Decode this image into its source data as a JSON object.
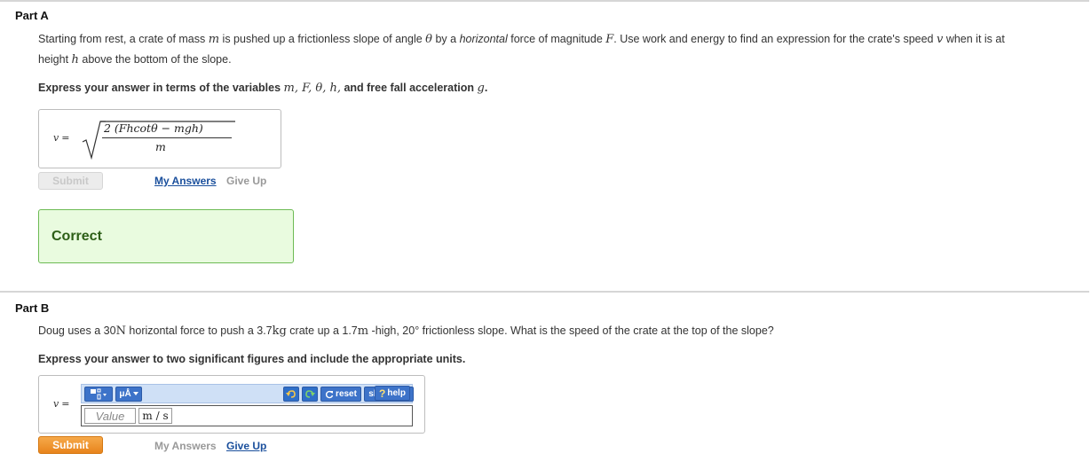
{
  "partA": {
    "title": "Part A",
    "q_p1": "Starting from rest, a crate of mass ",
    "q_m": "m",
    "q_p2": " is pushed up a frictionless slope of angle ",
    "q_theta": "θ",
    "q_p3": " by a ",
    "q_horizontal": "horizontal",
    "q_p4": " force of magnitude ",
    "q_F": "F",
    "q_p5": ". Use work and energy to find an expression for the crate's speed ",
    "q_v": "v",
    "q_p6": " when it is at",
    "q_p7": "height ",
    "q_h": "h",
    "q_p8": " above the bottom of the slope.",
    "instr_p1": "Express your answer in terms of the variables ",
    "instr_vars": "m, F, θ, h,",
    "instr_p2": " and free fall acceleration ",
    "instr_g": "g",
    "instr_p3": ".",
    "answer_var": "v",
    "answer_eq": "=",
    "answer_numerator": "2 (Fhcotθ − mgh)",
    "answer_denominator": "m",
    "submit_label": "Submit",
    "my_answers_label": "My Answers",
    "give_up_label": "Give Up",
    "correct_label": "Correct"
  },
  "partB": {
    "title": "Part B",
    "q_p1": "Doug uses a 30",
    "q_N": "N",
    "q_p2": " horizontal force to push a 3.7",
    "q_kg": "kg",
    "q_p3": " crate up a 1.7",
    "q_m": "m",
    "q_p4": " -high, 20° frictionless slope. What is the speed of the crate at the top of the slope?",
    "instr": "Express your answer to two significant figures and include the appropriate units.",
    "answer_var": "v",
    "answer_eq": "=",
    "toolbar": {
      "templates_icon": "templates-icon",
      "units_label": "μÅ",
      "undo_icon": "undo-icon",
      "redo_icon": "redo-icon",
      "reset_label": "reset",
      "shortcuts_label": "shortcuts",
      "help_label": "help",
      "help_glyph": "?"
    },
    "value_placeholder": "Value",
    "unit_value": "m / s",
    "submit_label": "Submit",
    "my_answers_label": "My Answers",
    "give_up_label": "Give Up"
  }
}
